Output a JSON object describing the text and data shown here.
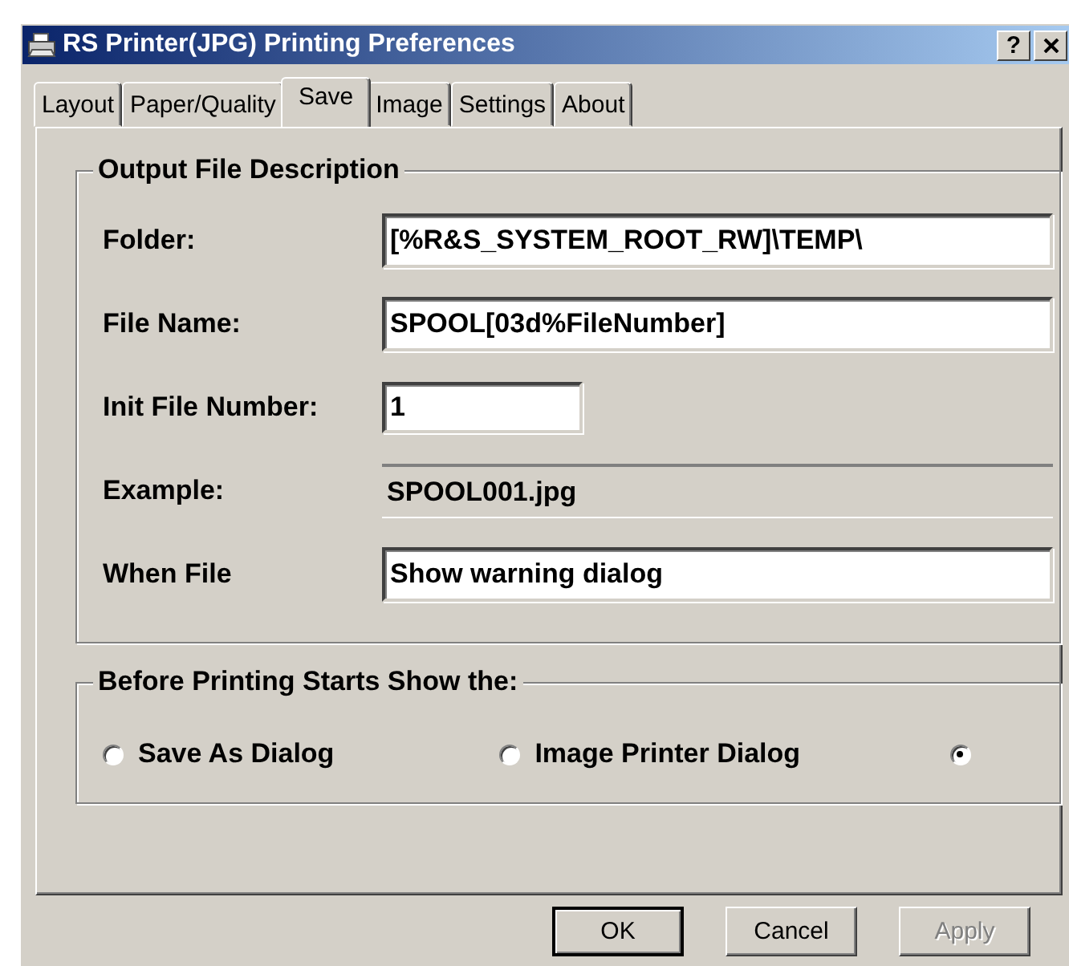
{
  "window": {
    "title": "RS Printer(JPG) Printing Preferences",
    "help_button": "?"
  },
  "tabs": [
    {
      "label": "Layout",
      "selected": false
    },
    {
      "label": "Paper/Quality",
      "selected": false
    },
    {
      "label": "Save",
      "selected": true
    },
    {
      "label": "Image",
      "selected": false
    },
    {
      "label": "Settings",
      "selected": false
    },
    {
      "label": "About",
      "selected": false
    }
  ],
  "output_file_description": {
    "title": "Output File Description",
    "rows": [
      {
        "label": "Folder:",
        "kind": "input",
        "value": "[%R&S_SYSTEM_ROOT_RW]\\TEMP\\"
      },
      {
        "label": "File Name:",
        "kind": "input",
        "value": "SPOOL[03d%FileNumber]"
      },
      {
        "label": "Init File Number:",
        "kind": "short",
        "value": "1"
      },
      {
        "label": "Example:",
        "kind": "readonly",
        "value": "SPOOL001.jpg"
      },
      {
        "label": "When File",
        "kind": "input",
        "value": "Show warning dialog"
      }
    ]
  },
  "before_printing": {
    "title": "Before Printing Starts Show the:",
    "options": [
      {
        "label": "Save As Dialog",
        "selected": false
      },
      {
        "label": "Image Printer Dialog",
        "selected": false
      },
      {
        "selected": true
      }
    ]
  },
  "buttons": [
    {
      "label": "OK",
      "default": true,
      "disabled": false
    },
    {
      "label": "Cancel",
      "default": false,
      "disabled": false
    },
    {
      "label": "Apply",
      "default": false,
      "disabled": true
    }
  ]
}
